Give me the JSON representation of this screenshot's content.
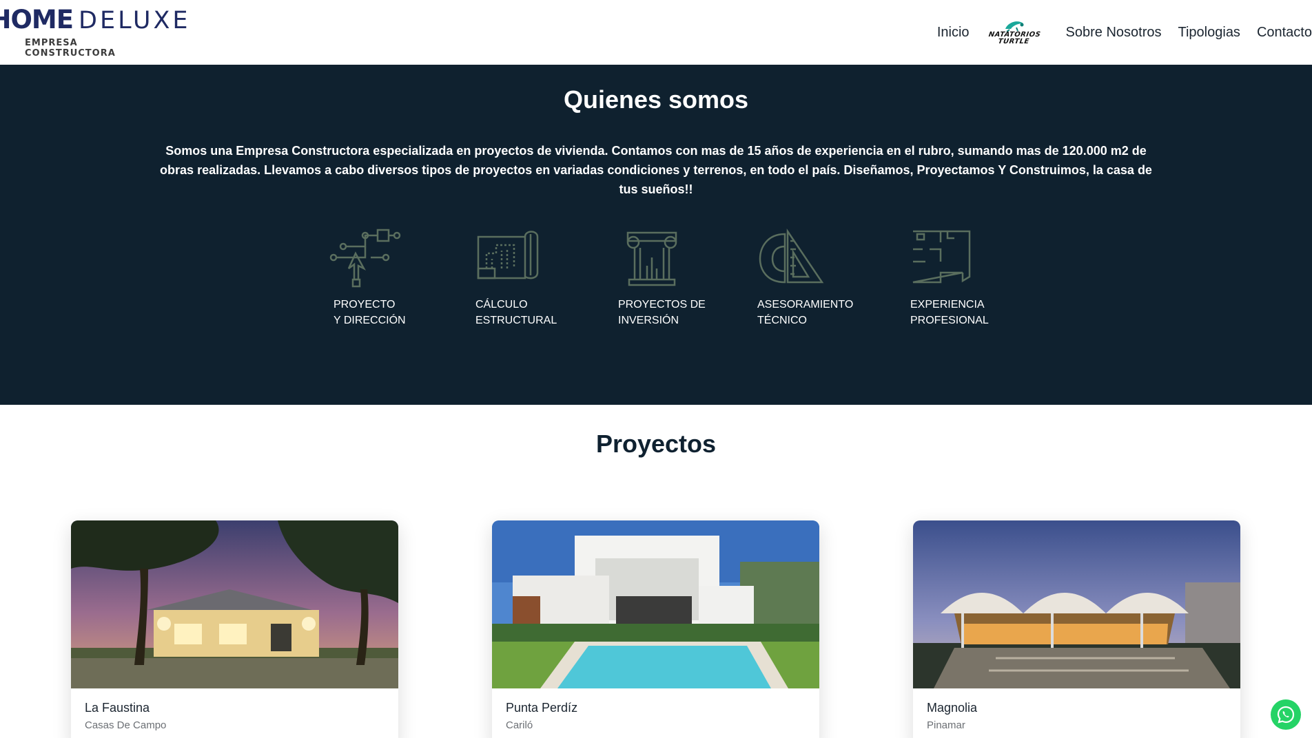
{
  "navbar": {
    "logo": {
      "home": "HOME",
      "deluxe": "DELUXE",
      "sub": "EMPRESA CONSTRUCTORA"
    },
    "links": [
      "Inicio",
      "Sobre Nosotros",
      "Tipologias",
      "Contacto"
    ],
    "brand": {
      "line1": "NATATORIOS",
      "line2": "TURTLE",
      "icon": "turtle-icon"
    }
  },
  "about": {
    "title": "Quienes somos",
    "text": "Somos una Empresa Constructora especializada en proyectos de vivienda. Contamos con mas de 15 años de experiencia en el rubro, sumando mas de 120.000 m2 de obras realizadas. Llevamos a cabo diversos tipos de proyectos en variadas condiciones y terrenos, en todo el país.",
    "text_emphasis": "Diseñamos, Proyectamos Y Construimos, la casa de tus sueños!!",
    "services": [
      {
        "line1": "PROYECTO",
        "line2": "Y DIRECCIÓN",
        "icon": "project-direction-icon"
      },
      {
        "line1": "CÁLCULO",
        "line2": "ESTRUCTURAL",
        "icon": "blueprint-icon"
      },
      {
        "line1": "PROYECTOS DE",
        "line2": "INVERSIÓN",
        "icon": "column-chart-icon"
      },
      {
        "line1": "ASESORAMIENTO",
        "line2": "TÉCNICO",
        "icon": "protractor-ruler-icon"
      },
      {
        "line1": "EXPERIENCIA",
        "line2": "PROFESIONAL",
        "icon": "floor-plan-icon"
      }
    ],
    "icon_color": "#5a6e5e"
  },
  "projects": {
    "title": "Proyectos",
    "cards": [
      {
        "title": "La Faustina",
        "subtitle": "Casas De Campo"
      },
      {
        "title": "Punta Perdíz",
        "subtitle": "Cariló"
      },
      {
        "title": "Magnolia",
        "subtitle": "Pinamar"
      }
    ]
  },
  "colors": {
    "brand_navy": "#1f2a63",
    "dark_bg": "#0f212f",
    "whatsapp": "#25d366"
  }
}
